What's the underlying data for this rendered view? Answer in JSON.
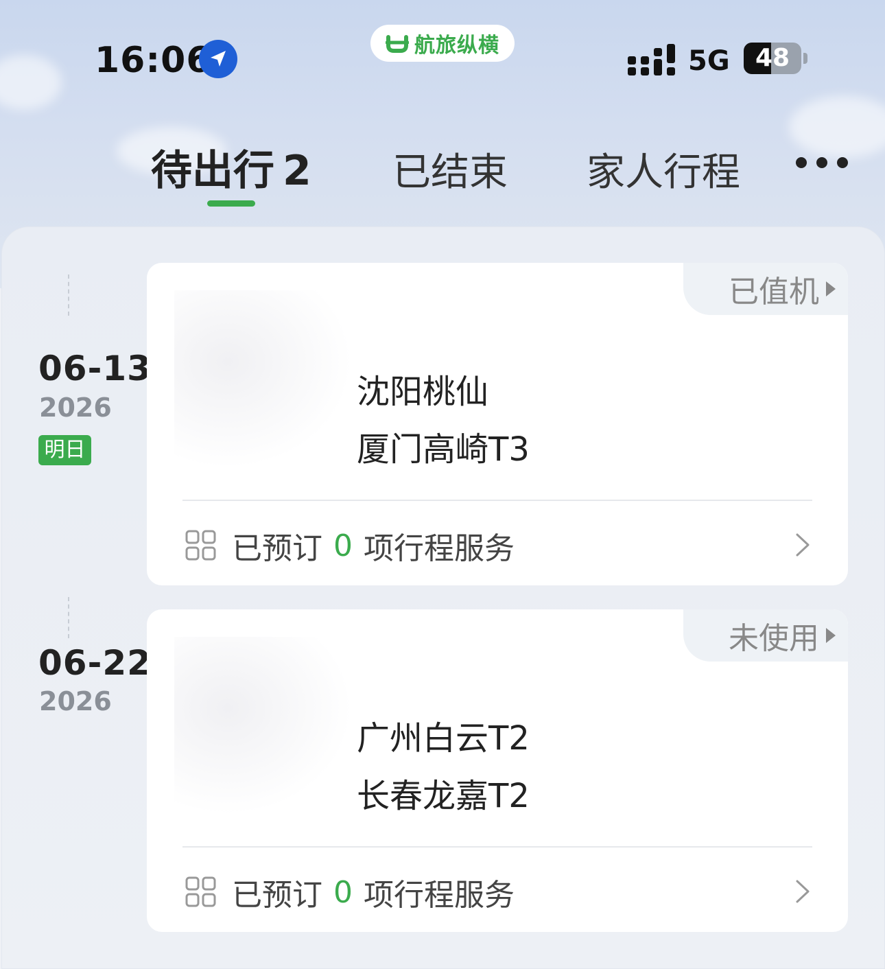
{
  "status_bar": {
    "time": "16:06",
    "network": "5G",
    "battery": "48",
    "battery_level_percent": 48,
    "brand": "航旅纵横"
  },
  "tabs": {
    "upcoming_label": "待出行",
    "upcoming_count": "2",
    "ended_label": "已结束",
    "family_label": "家人行程"
  },
  "colors": {
    "accent_green": "#3bab4d",
    "text_dark": "#222222",
    "text_muted": "#888888"
  },
  "trips": [
    {
      "date": "06-13",
      "year": "2026",
      "tag": "明日",
      "status": "已值机",
      "from": "沈阳桃仙",
      "to": "厦门高崎T3",
      "footer_prefix": "已预订",
      "footer_count": "0",
      "footer_suffix": "项行程服务"
    },
    {
      "date": "06-22",
      "year": "2026",
      "status": "未使用",
      "from": "广州白云T2",
      "to": "长春龙嘉T2",
      "footer_prefix": "已预订",
      "footer_count": "0",
      "footer_suffix": "项行程服务"
    }
  ]
}
